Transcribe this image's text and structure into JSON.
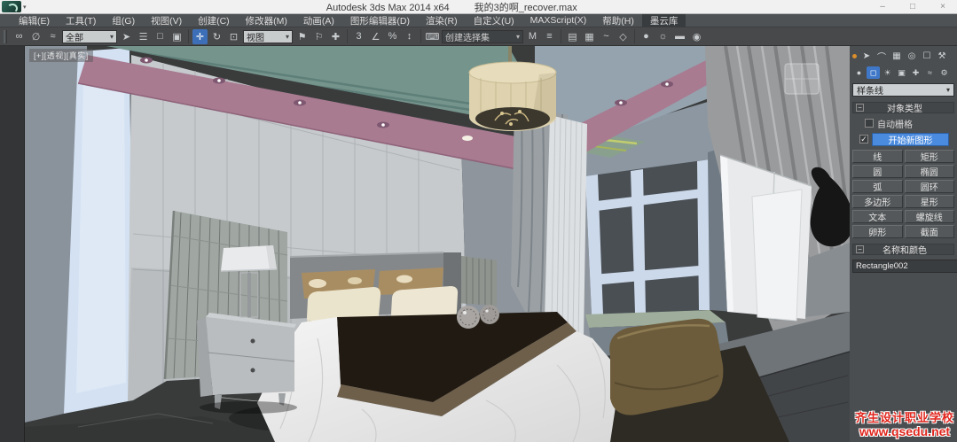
{
  "title_bar": {
    "title": "Autodesk 3ds Max  2014 x64",
    "file": "我的3的啊_recover.max",
    "minimize": "–",
    "maximize": "□",
    "close": "×"
  },
  "menu_bar": {
    "items": [
      "编辑(E)",
      "工具(T)",
      "组(G)",
      "视图(V)",
      "创建(C)",
      "修改器(M)",
      "动画(A)",
      "图形编辑器(D)",
      "渲染(R)",
      "自定义(U)",
      "MAXScript(X)",
      "帮助(H)",
      "墨云库"
    ]
  },
  "toolbar": {
    "glyphs": [
      "∞",
      "∅",
      "≈",
      "➤",
      "☰",
      "□",
      "▣",
      "✛",
      "↻",
      "⊡",
      "⚑",
      "⚐",
      "✚",
      "3",
      "∠",
      "%",
      "↕",
      "⌨",
      "M",
      "≡",
      "▤",
      "▦",
      "~",
      "◇",
      "●",
      "☼",
      "▬",
      "◉"
    ],
    "filter_value": "全部",
    "coord_value": "视图",
    "named_sets_value": "创建选择集"
  },
  "viewport": {
    "label": "[+][透视][真实]"
  },
  "command_panel": {
    "tab_glyphs": [
      "➤",
      "⌒",
      "▦",
      "◎",
      "☐",
      "⚒"
    ],
    "category_glyphs": [
      "●",
      "◻",
      "☀",
      "▣",
      "✚",
      "≈",
      "⚙"
    ],
    "spline_type_dropdown": "样条线",
    "rollout_object_type": "对象类型",
    "autogrid_label": "自动栅格",
    "start_new_shape_label": "开始新图形",
    "shape_buttons": [
      [
        "线",
        "矩形"
      ],
      [
        "圆",
        "椭圆"
      ],
      [
        "弧",
        "圆环"
      ],
      [
        "多边形",
        "星形"
      ],
      [
        "文本",
        "螺旋线"
      ],
      [
        "卵形",
        "截面"
      ]
    ],
    "rollout_name_color": "名称和颜色",
    "object_name": "Rectangle002"
  },
  "watermark": {
    "line1": "齐生设计职业学校",
    "line2": "www.qsedu.net"
  },
  "glyphs": {
    "chevron": "▾",
    "minus": "−",
    "check": "✓"
  },
  "colors": {
    "accent_blue": "#4b8bdf",
    "active_tool_blue": "#3d6fb8",
    "swatch_green": "#86d79c",
    "watermark_red": "#e0251c",
    "ceiling_mauve": "#a87b91",
    "ceiling_teal": "#75948c",
    "panel_bg": "#4b4e50",
    "menubar_bg": "#4f5254"
  }
}
